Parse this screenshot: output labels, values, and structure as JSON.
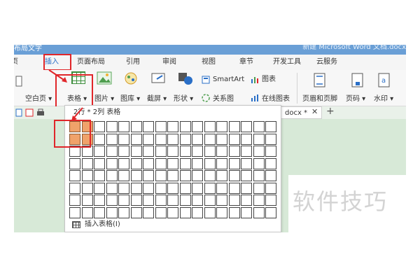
{
  "window": {
    "title_left": "布局文字",
    "title_right": "新建 Microsoft Word 文档.docx"
  },
  "tabs": [
    {
      "label": "首页"
    },
    {
      "label": "插入",
      "active": true
    },
    {
      "label": "页面布局"
    },
    {
      "label": "引用"
    },
    {
      "label": "审阅"
    },
    {
      "label": "视图"
    },
    {
      "label": "章节"
    },
    {
      "label": "开发工具"
    },
    {
      "label": "云服务"
    }
  ],
  "ribbon": {
    "blank_page": "空白页 ▾",
    "table": "表格 ▾",
    "picture": "图片 ▾",
    "gallery": "图库 ▾",
    "screenshot": "截屏 ▾",
    "shapes": "形状 ▾",
    "smartart": "SmartArt",
    "chart": "图表",
    "relation_chart": "关系图",
    "online_chart": "在线图表",
    "header_footer": "页眉和页脚",
    "page_number": "页码 ▾",
    "watermark": "水印 ▾"
  },
  "document": {
    "tab_name": "docx *",
    "close": "✕",
    "add": "+",
    "watermark_text": "软件技巧"
  },
  "table_dropdown": {
    "header": "2行 * 2列 表格",
    "rows": 8,
    "cols": 17,
    "selected_rows": 2,
    "selected_cols": 2,
    "footer_label": "插入表格(I)"
  },
  "colors": {
    "accent_blue": "#2a6fc7",
    "highlight_red": "#e0262a",
    "cell_selected": "#f0a26a",
    "background_green": "#d7e9d7"
  }
}
